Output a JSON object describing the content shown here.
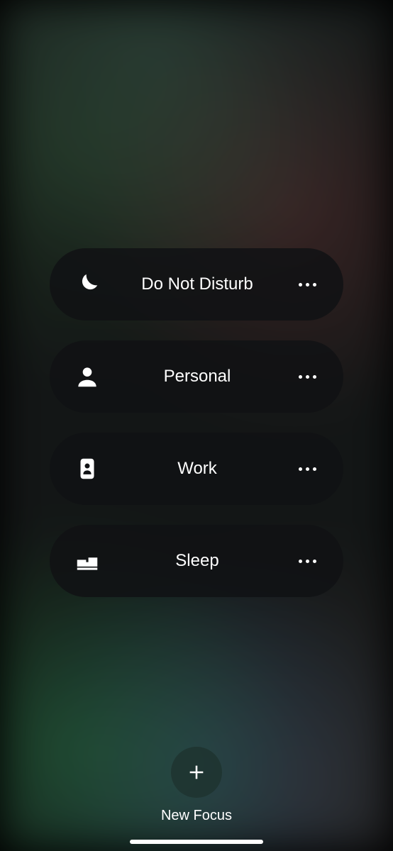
{
  "focus_modes": [
    {
      "icon": "moon-icon",
      "label": "Do Not Disturb"
    },
    {
      "icon": "person-icon",
      "label": "Personal"
    },
    {
      "icon": "badge-icon",
      "label": "Work"
    },
    {
      "icon": "bed-icon",
      "label": "Sleep"
    }
  ],
  "new_focus": {
    "label": "New Focus"
  }
}
